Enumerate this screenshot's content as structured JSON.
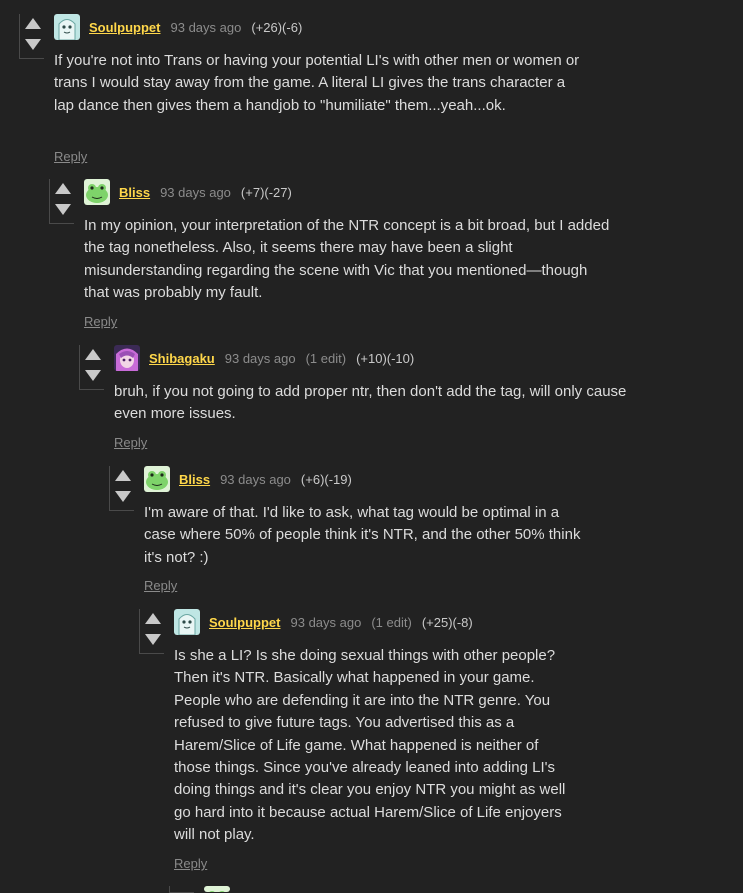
{
  "comments": [
    {
      "author": "Soulpuppet",
      "date": "93 days ago",
      "edited": "",
      "score": "(+26)(-6)",
      "body": "If you're not into Trans or having your potential LI's with other men or women or trans I would stay away from the game. A literal LI gives the trans character a lap dance then gives them a handjob to \"humiliate\" them...yeah...ok.",
      "reply": "Reply"
    },
    {
      "author": "Bliss",
      "date": "93 days ago",
      "edited": "",
      "score": "(+7)(-27)",
      "body": "In my opinion, your interpretation of the NTR concept is a bit broad, but I added the tag nonetheless. Also, it seems there may have been a slight misunderstanding regarding the scene with Vic that you mentioned—though that was probably my fault.",
      "reply": "Reply"
    },
    {
      "author": "Shibagaku",
      "date": "93 days ago",
      "edited": "(1 edit)",
      "score": "(+10)(-10)",
      "body": "bruh, if you not going to add proper ntr, then don't add the tag, will only cause even more issues.",
      "reply": "Reply"
    },
    {
      "author": "Bliss",
      "date": "93 days ago",
      "edited": "",
      "score": "(+6)(-19)",
      "body": "I'm aware of that. I'd like to ask, what tag would be optimal in a case where 50% of people think it's NTR, and the other 50% think it's not? :)",
      "reply": "Reply"
    },
    {
      "author": "Soulpuppet",
      "date": "93 days ago",
      "edited": "(1 edit)",
      "score": "(+25)(-8)",
      "body": "Is she a LI? Is she doing sexual things with other people? Then it's NTR. Basically what happened in your game. People who are defending it are into the NTR genre. You refused to give future tags. You advertised this as a Harem/Slice of Life game. What happened is neither of those things. Since you've already leaned into adding LI's doing things and it's clear you enjoy NTR you might as well go hard into it because actual Harem/Slice of Life enjoyers will not play.",
      "reply": "Reply"
    }
  ]
}
